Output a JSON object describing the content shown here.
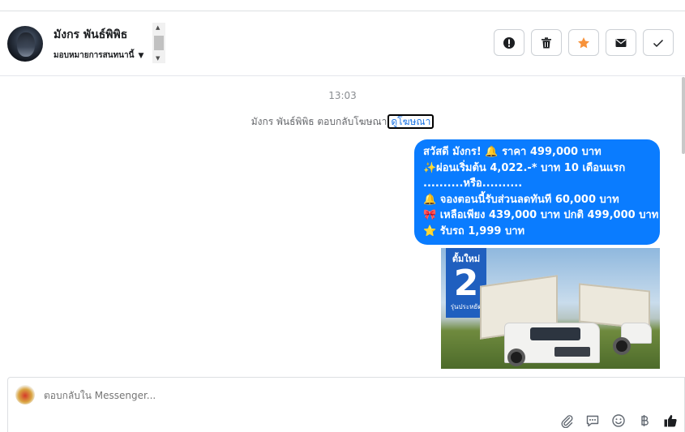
{
  "header": {
    "contact_name": "มังกร พันธ์พิพิธ",
    "assign_label": "มอบหมายการสนทนานี้",
    "actions": [
      {
        "name": "report-button",
        "icon": "alert-icon"
      },
      {
        "name": "delete-button",
        "icon": "trash-icon"
      },
      {
        "name": "star-button",
        "icon": "star-icon"
      },
      {
        "name": "mark-unread-button",
        "icon": "envelope-icon"
      },
      {
        "name": "mark-done-button",
        "icon": "check-icon"
      }
    ]
  },
  "thread": {
    "timestamp": "13:03",
    "notice_text": "มังกร พันธ์พิพิธ ตอบกลับโฆษณา",
    "notice_link": "ดูโฆษณา",
    "message_lines": [
      "สวัสดี มังกร! 🔔 ราคา 499,000 บาท",
      "✨ผ่อนเริ่มต้น 4,022.-* บาท 10 เดือนแรก",
      "..........หรือ..........",
      "🔔 จองตอนนี้รับส่วนลดทันที 60,000 บาท",
      "🎀 เหลือเพียง 439,000 บาท ปกติ 499,000 บาท",
      "⭐ รับรถ 1,999 บาท"
    ],
    "ad_badge": {
      "line1": "ตั้มใหม่",
      "line2": "2",
      "line3": "รุ่นประหยัด"
    }
  },
  "composer": {
    "placeholder": "ตอบกลับใน Messenger..."
  },
  "colors": {
    "bubble": "#0a7cff",
    "star": "#f7923a",
    "link": "#1b74e4"
  }
}
